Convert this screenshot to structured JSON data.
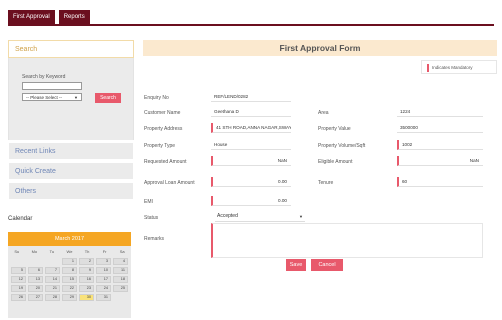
{
  "tabs": [
    "First Approval",
    "Reports"
  ],
  "sidebar": {
    "search_title": "Search",
    "search_by_label": "Search by Keyword",
    "select_placeholder": "-- Please Select --",
    "search_button": "Search",
    "items": [
      "Recent Links",
      "Quick Create",
      "Others"
    ],
    "calendar_label": "Calendar"
  },
  "calendar": {
    "month": "March 2017",
    "days_of_week": [
      "Su",
      "Mo",
      "Tu",
      "We",
      "Th",
      "Fr",
      "Sa"
    ],
    "weeks": [
      [
        "",
        "",
        "",
        "1",
        "2",
        "3",
        "4"
      ],
      [
        "5",
        "6",
        "7",
        "8",
        "9",
        "10",
        "11"
      ],
      [
        "12",
        "13",
        "14",
        "15",
        "16",
        "17",
        "18"
      ],
      [
        "19",
        "20",
        "21",
        "22",
        "23",
        "24",
        "25"
      ],
      [
        "26",
        "27",
        "28",
        "29",
        "30",
        "31",
        ""
      ]
    ],
    "today": "30"
  },
  "form": {
    "title": "First Approval Form",
    "indicates_mandatory": "Indicates Mandatory",
    "enquiry_no_label": "Enquiry No",
    "enquiry_no": "REF/LEND/0282",
    "customer_name_label": "Customer Name",
    "customer_name": "Geethana D",
    "area_label": "Area",
    "area": "1224",
    "property_address_label": "Property Address",
    "property_address": "41 STH ROAD,ANNA NAGAR,SWAYA",
    "property_value_label": "Property Value",
    "property_value": "3500000",
    "property_type_label": "Property Type",
    "property_type": "House",
    "property_volume_label": "Property Volume/Sqft",
    "property_volume": "1002",
    "requested_amount_label": "Requested Amount",
    "requested_amount": "NaN",
    "eligible_amount_label": "Eligible Amount",
    "eligible_amount": "NaN",
    "approved_loan_amount_label": "Approval Loan Amount",
    "approved_loan_amount": "0.00",
    "tenure_label": "Tenure",
    "tenure": "60",
    "emi_label": "EMI",
    "emi": "0.00",
    "status_label": "Status",
    "status": "Accepted",
    "remarks_label": "Remarks",
    "save_button": "Save",
    "cancel_button": "Cancel"
  },
  "colors": {
    "tab_bg": "#6b0f1f",
    "accent": "#e8596b",
    "calendar_header": "#f5a623",
    "form_header": "#fbe9cf"
  }
}
